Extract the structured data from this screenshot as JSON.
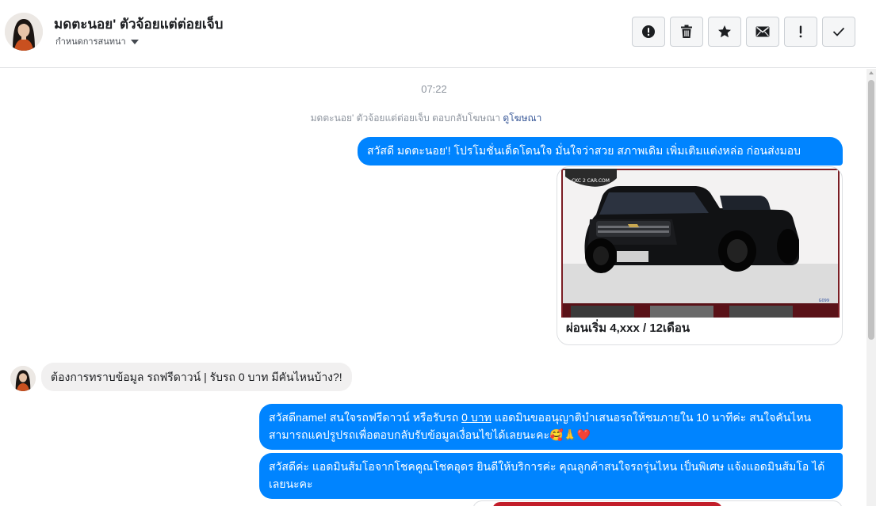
{
  "header": {
    "contact_name": "มดตะนอย' ตัวจ้อยแต่ต่อยเจ็บ",
    "assign_label": "กำหนดการสนทนา",
    "toolbar": [
      {
        "name": "report-button",
        "icon": "exclamation-circle-icon"
      },
      {
        "name": "delete-button",
        "icon": "trash-icon"
      },
      {
        "name": "star-button",
        "icon": "star-icon"
      },
      {
        "name": "mark-unread-button",
        "icon": "envelope-icon"
      },
      {
        "name": "spam-button",
        "icon": "exclamation-icon"
      },
      {
        "name": "done-button",
        "icon": "check-icon"
      }
    ]
  },
  "conversation": {
    "timestamp": "07:22",
    "replied_note": {
      "text": "มดตะนอย' ตัวจ้อยแต่ต่อยเจ็บ ตอบกลับโฆษณา ",
      "link": "ดูโฆษณา"
    },
    "messages": [
      {
        "direction": "outgoing",
        "text": "สวัสดี มดตะนอย'! โปรโมชั่นเด็ดโดนใจ มั่นใจว่าสวย สภาพเดิม เพิ่มเติมแต่งหล่อ ก่อนส่งมอบ"
      },
      {
        "direction": "outgoing",
        "type": "ad-card",
        "caption": "ผ่อนเริ่ม 4,xxx / 12เดือน",
        "image_badge": "CKC 2 CAR.COM"
      },
      {
        "direction": "incoming",
        "text": "ต้องการทราบข้อมูล รถฟรีดาวน์ | รับรถ 0 บาท มีคันไหนบ้าง?!"
      },
      {
        "direction": "outgoing",
        "text_before": "สวัสดีname! สนใจรถฟรีดาวน์ หรือรับรถ ",
        "text_underlined": "0 บาท",
        "text_after": " แอดมินขออนุญาติบำเสนอรถให้ชมภายใน 10 นาทีค่ะ สนใจคันไหนสามารถแคปรูปรถเพื่อตอบกลับรับข้อมูลเงื่อนไขได้เลยนะคะ🥰🙏❤️"
      },
      {
        "direction": "outgoing",
        "text": "สวัสดีค่ะ แอดมินส้มโอจากโชคคูณโชคอุดร ยินดีให้บริการค่ะ   คุณลูกค้าสนใจรถรุ่นไหน เป็นพิเศษ แจ้งแอดมินส้มโอ ได้เลยนะคะ"
      }
    ]
  },
  "colors": {
    "outgoing_bubble": "#0084ff",
    "incoming_bubble": "#f1f0f0",
    "link": "#385898"
  }
}
